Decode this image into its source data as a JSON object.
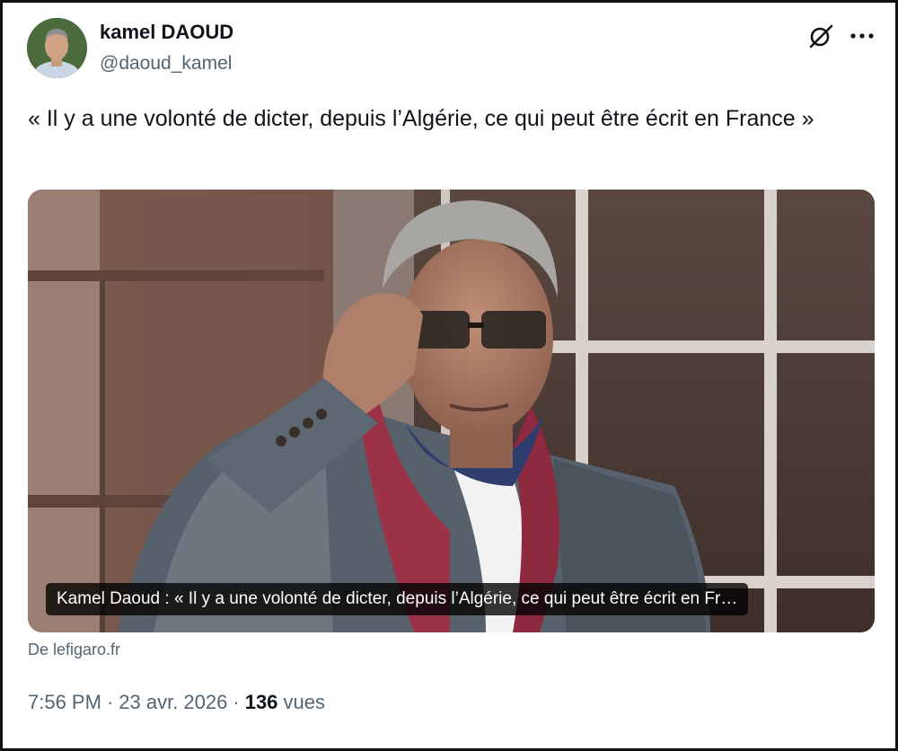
{
  "author": {
    "display_name": "kamel DAOUD",
    "handle": "@daoud_kamel"
  },
  "header_icons": {
    "grok": "grok-icon",
    "more": "more-options-icon"
  },
  "tweet": {
    "text": "« Il y a une volonté de dicter, depuis l’Algérie, ce qui peut être écrit en France »"
  },
  "card": {
    "caption": "Kamel Daoud : « Il y a une volonté de dicter, depuis l’Algérie, ce qui peut être écrit en Fr…",
    "source": "De lefigaro.fr"
  },
  "meta": {
    "time": "7:56 PM",
    "date": "23 avr. 2026",
    "views_count": "136",
    "views_label": "vues",
    "separator": "·"
  }
}
